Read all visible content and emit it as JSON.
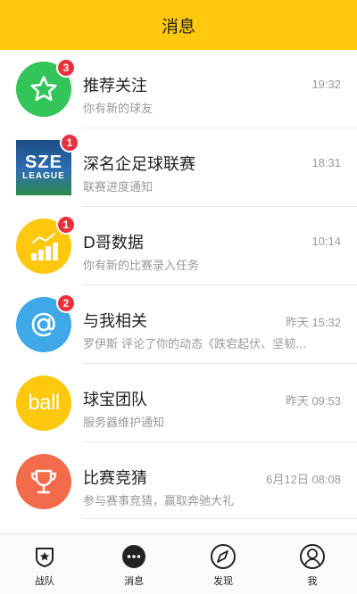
{
  "header": {
    "title": "消息"
  },
  "messages": [
    {
      "title": "推荐关注",
      "subtitle": "你有新的球友",
      "time": "19:32",
      "badge": "3",
      "icon": "star-icon",
      "color": "#33c55a"
    },
    {
      "title": "深名企足球联赛",
      "subtitle": "联赛进度通知",
      "time": "18:31",
      "badge": "1",
      "icon": "league-logo",
      "logo_line1": "SZE",
      "logo_line2": "LEAGUE"
    },
    {
      "title": "D哥数据",
      "subtitle": "你有新的比赛录入任务",
      "time": "10:14",
      "badge": "1",
      "icon": "chart-icon",
      "color": "#fdc80e"
    },
    {
      "title": "与我相关",
      "subtitle": "罗伊斯 评论了你的动态《跌宕起伏、坚韧...",
      "time": "昨天 15:32",
      "badge": "2",
      "icon": "at-icon",
      "color": "#3fa9e8"
    },
    {
      "title": "球宝团队",
      "subtitle": "服务器维护通知",
      "time": "昨天 09:53",
      "badge": "",
      "icon": "ball-logo",
      "logo_text": "ball",
      "color": "#fdc80e"
    },
    {
      "title": "比赛竞猜",
      "subtitle": "参与赛事竞猜，赢取奔驰大礼",
      "time": "6月12日 08:08",
      "badge": "",
      "icon": "trophy-icon",
      "color": "#f26b4a"
    }
  ],
  "tabs": [
    {
      "label": "战队",
      "icon": "team-shield-icon",
      "active": false
    },
    {
      "label": "消息",
      "icon": "message-icon",
      "active": true
    },
    {
      "label": "发现",
      "icon": "discover-icon",
      "active": false
    },
    {
      "label": "我",
      "icon": "profile-icon",
      "active": false
    }
  ]
}
